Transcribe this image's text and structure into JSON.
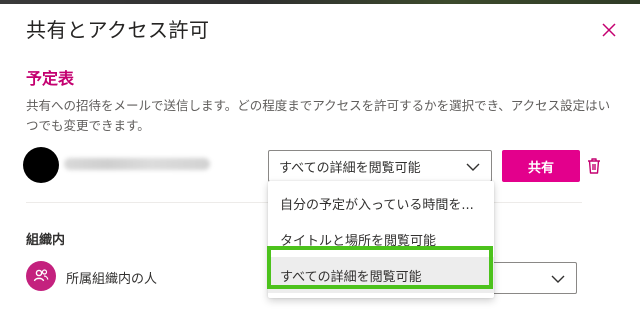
{
  "dialog": {
    "title": "共有とアクセス許可",
    "close_icon": "close-icon"
  },
  "calendar": {
    "name": "予定表",
    "description": "共有への招待をメールで送信します。どの程度までアクセスを許可するかを選択でき、アクセス設定はいつでも変更できます。"
  },
  "recipient": {
    "selected_permission": "すべての詳細を閲覧可能",
    "share_label": "共有"
  },
  "permission_menu": {
    "options": [
      "自分の予定が入っている時間を...",
      "タイトルと場所を閲覧可能",
      "すべての詳細を閲覧可能"
    ],
    "selected_index": 2
  },
  "organization": {
    "heading": "組織内",
    "label": "所属組織内の人"
  },
  "colors": {
    "accent": "#c40070",
    "share_button": "#e3008c",
    "highlight_border": "#4cc21c",
    "org_avatar": "#c4217e"
  }
}
